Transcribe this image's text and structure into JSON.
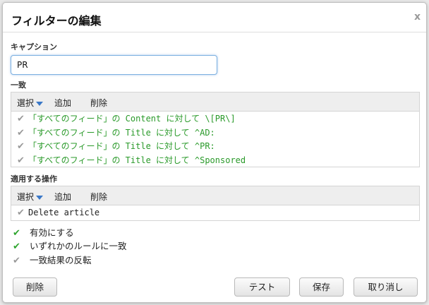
{
  "dialog": {
    "title": "フィルターの編集",
    "close_glyph": "x"
  },
  "caption": {
    "label": "キャプション",
    "value": "PR"
  },
  "match": {
    "label": "一致",
    "toolbar": {
      "select": "選択",
      "add": "追加",
      "delete": "削除"
    },
    "rules": [
      "「すべてのフィード」の Content に対して \\[PR\\]",
      "「すべてのフィード」の Title に対して ^AD:",
      "「すべてのフィード」の Title に対して ^PR:",
      "「すべてのフィード」の Title に対して ^Sponsored"
    ]
  },
  "actions": {
    "label": "適用する操作",
    "toolbar": {
      "select": "選択",
      "add": "追加",
      "delete": "削除"
    },
    "items": [
      "Delete article"
    ]
  },
  "options": [
    {
      "label": "有効にする",
      "checked": true
    },
    {
      "label": "いずれかのルールに一致",
      "checked": true
    },
    {
      "label": "一致結果の反転",
      "checked": false
    }
  ],
  "buttons": {
    "remove": "削除",
    "test": "テスト",
    "save": "保存",
    "cancel": "取り消し"
  },
  "icons": {
    "check": "check-icon",
    "dropdown": "chevron-down-icon"
  },
  "colors": {
    "rule_text": "#2a9a2a",
    "check_on": "#2ea52e",
    "check_off": "#999999",
    "focus_border": "#7cb0e0"
  }
}
